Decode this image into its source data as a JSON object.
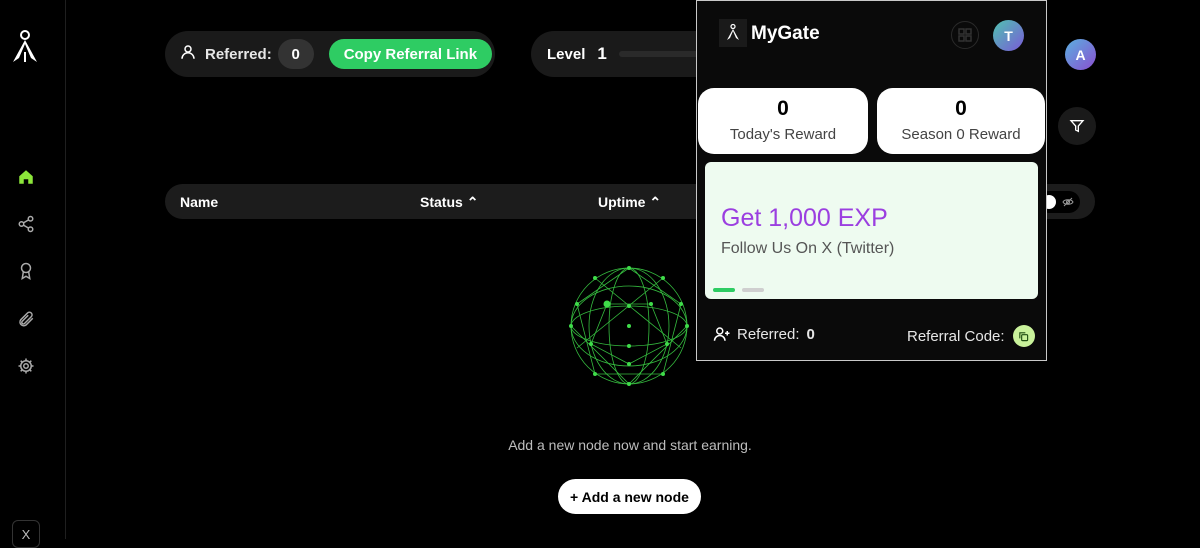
{
  "sidebar": {
    "items": [
      {
        "icon": "home-icon",
        "active": true
      },
      {
        "icon": "share-icon"
      },
      {
        "icon": "award-icon"
      },
      {
        "icon": "link-icon"
      },
      {
        "icon": "gear-icon"
      }
    ],
    "x_label": "X"
  },
  "header": {
    "referred_label": "Referred:",
    "referred_count": "0",
    "copy_link_label": "Copy Referral Link",
    "level_label": "Level",
    "level_value": "1",
    "avatar_initial": "A"
  },
  "table": {
    "columns": [
      "Name",
      "Status",
      "Uptime"
    ],
    "sort_arrow": "^"
  },
  "empty_state": {
    "message": "Add a new node now and start earning.",
    "add_button": "+ Add a new node"
  },
  "popup": {
    "title": "MyGate",
    "avatar_initial": "T",
    "todays_reward_value": "0",
    "todays_reward_label": "Today's Reward",
    "season_reward_value": "0",
    "season_reward_label": "Season 0 Reward",
    "promo_title": "Get 1,000 EXP",
    "promo_subtitle": "Follow Us On X (Twitter)",
    "referred_label": "Referred:",
    "referred_count": "0",
    "referral_code_label": "Referral Code:"
  },
  "colors": {
    "accent_green": "#2ecc63",
    "promo_purple": "#9b3fe0",
    "globe_green": "#3fdc4a"
  }
}
